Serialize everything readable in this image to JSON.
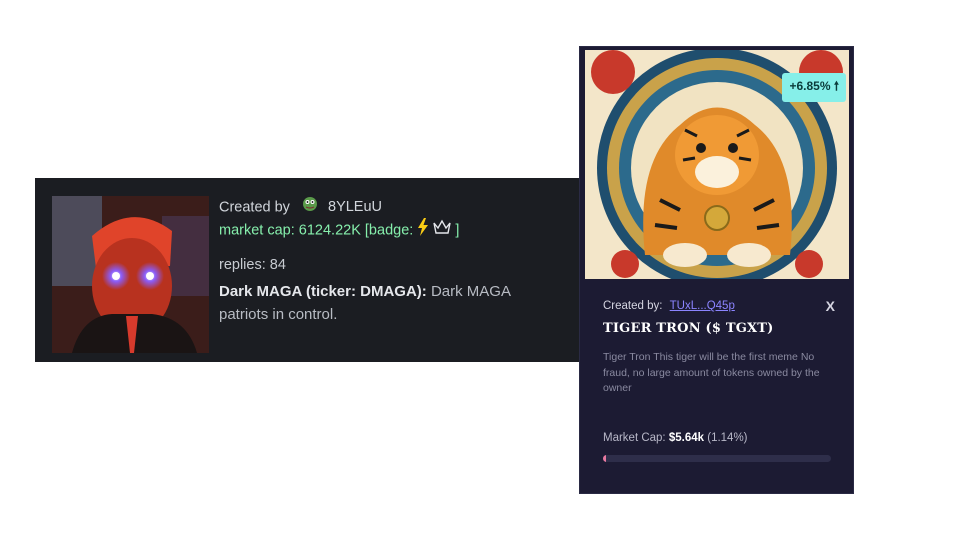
{
  "left_card": {
    "created_label": "Created by",
    "creator": "8YLEuU",
    "market_cap": "market cap: 6124.22K",
    "badge_open": "[badge:",
    "badge_close": "]",
    "replies": "replies: 84",
    "title": "Dark MAGA (ticker: DMAGA):",
    "description": "Dark MAGA patriots in control."
  },
  "right_card": {
    "change": "+6.85% 🠕",
    "created_label": "Created by:",
    "creator": "TUxL...Q45p",
    "x_icon": "X",
    "token_name": "TIGER TRON ($ TGXT)",
    "description": "Tiger Tron This tiger will be the first meme No fraud, no large amount of tokens owned by the owner",
    "market_cap_label": "Market Cap:",
    "market_cap_value": "$5.64k",
    "market_cap_pct": "(1.14%)",
    "progress_fraction": 0.0114
  },
  "colors": {
    "left_bg": "#1b1d22",
    "right_bg": "#1c1b33",
    "green": "#86efac",
    "link": "#8b84ff",
    "change_badge": "#86efe9",
    "progress": "#e879a0"
  },
  "icons": [
    "pepe-avatar-icon",
    "lightning-icon",
    "crown-icon",
    "x-icon",
    "up-arrow-icon"
  ]
}
